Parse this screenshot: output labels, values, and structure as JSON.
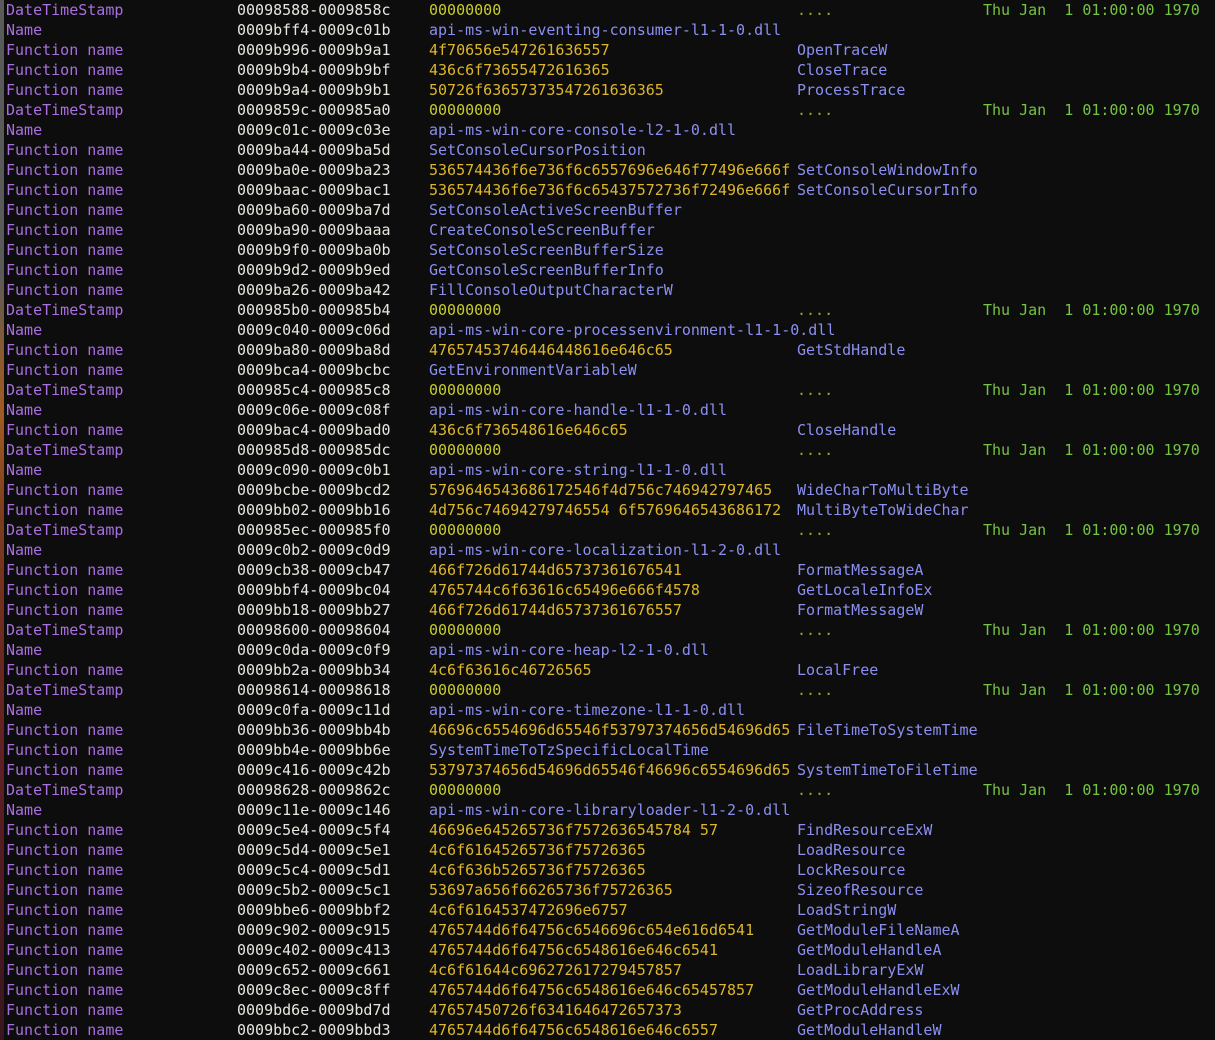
{
  "terminal": {
    "background": "#0d0d0d",
    "colors": {
      "label": "#a96fe0",
      "range": "#e8e6df",
      "hex": "#ddb62c",
      "zero": "#c8cc2e",
      "dots": "#9aa830",
      "name": "#8b8ff0",
      "date": "#74c441"
    },
    "dots_value": "....",
    "edge_strip": "scroll-position-indicator"
  },
  "rows": [
    {
      "label": "DateTimeStamp",
      "range": "00098588-0009858c",
      "value": "00000000",
      "kind": "zero",
      "fn": "....",
      "date": "Thu Jan  1 01:00:00 1970"
    },
    {
      "label": "Name",
      "range": "0009bff4-0009c01b",
      "value": "api-ms-win-eventing-consumer-l1-1-0.dll",
      "kind": "modname",
      "fn": "",
      "date": ""
    },
    {
      "label": "Function name",
      "range": "0009b996-0009b9a1",
      "value": "4f70656e547261636557",
      "kind": "hex",
      "fn": "OpenTraceW",
      "date": ""
    },
    {
      "label": "Function name",
      "range": "0009b9b4-0009b9bf",
      "value": "436c6f73655472616365",
      "kind": "hex",
      "fn": "CloseTrace",
      "date": ""
    },
    {
      "label": "Function name",
      "range": "0009b9a4-0009b9b1",
      "value": "50726f63657373547261636365",
      "kind": "hex",
      "fn": "ProcessTrace",
      "date": ""
    },
    {
      "label": "DateTimeStamp",
      "range": "0009859c-000985a0",
      "value": "00000000",
      "kind": "zero",
      "fn": "....",
      "date": "Thu Jan  1 01:00:00 1970"
    },
    {
      "label": "Name",
      "range": "0009c01c-0009c03e",
      "value": "api-ms-win-core-console-l2-1-0.dll",
      "kind": "modname",
      "fn": "",
      "date": ""
    },
    {
      "label": "Function name",
      "range": "0009ba44-0009ba5d",
      "value": "SetConsoleCursorPosition",
      "kind": "modname",
      "fn": "",
      "date": ""
    },
    {
      "label": "Function name",
      "range": "0009ba0e-0009ba23",
      "value": "536574436f6e736f6c6557696e646f77496e666f",
      "kind": "hex",
      "fn": "SetConsoleWindowInfo",
      "date": ""
    },
    {
      "label": "Function name",
      "range": "0009baac-0009bac1",
      "value": "536574436f6e736f6c65437572736f72496e666f",
      "kind": "hex",
      "fn": "SetConsoleCursorInfo",
      "date": ""
    },
    {
      "label": "Function name",
      "range": "0009ba60-0009ba7d",
      "value": "SetConsoleActiveScreenBuffer",
      "kind": "modname",
      "fn": "",
      "date": ""
    },
    {
      "label": "Function name",
      "range": "0009ba90-0009baaa",
      "value": "CreateConsoleScreenBuffer",
      "kind": "modname",
      "fn": "",
      "date": ""
    },
    {
      "label": "Function name",
      "range": "0009b9f0-0009ba0b",
      "value": "SetConsoleScreenBufferSize",
      "kind": "modname",
      "fn": "",
      "date": ""
    },
    {
      "label": "Function name",
      "range": "0009b9d2-0009b9ed",
      "value": "GetConsoleScreenBufferInfo",
      "kind": "modname",
      "fn": "",
      "date": ""
    },
    {
      "label": "Function name",
      "range": "0009ba26-0009ba42",
      "value": "FillConsoleOutputCharacterW",
      "kind": "modname",
      "fn": "",
      "date": ""
    },
    {
      "label": "DateTimeStamp",
      "range": "000985b0-000985b4",
      "value": "00000000",
      "kind": "zero",
      "fn": "....",
      "date": "Thu Jan  1 01:00:00 1970"
    },
    {
      "label": "Name",
      "range": "0009c040-0009c06d",
      "value": "api-ms-win-core-processenvironment-l1-1-0.dll",
      "kind": "modname",
      "fn": "",
      "date": ""
    },
    {
      "label": "Function name",
      "range": "0009ba80-0009ba8d",
      "value": "47657453746446448616e646c65",
      "kind": "hex",
      "fn": "GetStdHandle",
      "date": ""
    },
    {
      "label": "Function name",
      "range": "0009bca4-0009bcbc",
      "value": "GetEnvironmentVariableW",
      "kind": "modname",
      "fn": "",
      "date": ""
    },
    {
      "label": "DateTimeStamp",
      "range": "000985c4-000985c8",
      "value": "00000000",
      "kind": "zero",
      "fn": "....",
      "date": "Thu Jan  1 01:00:00 1970"
    },
    {
      "label": "Name",
      "range": "0009c06e-0009c08f",
      "value": "api-ms-win-core-handle-l1-1-0.dll",
      "kind": "modname",
      "fn": "",
      "date": ""
    },
    {
      "label": "Function name",
      "range": "0009bac4-0009bad0",
      "value": "436c6f736548616e646c65",
      "kind": "hex",
      "fn": "CloseHandle",
      "date": ""
    },
    {
      "label": "DateTimeStamp",
      "range": "000985d8-000985dc",
      "value": "00000000",
      "kind": "zero",
      "fn": "....",
      "date": "Thu Jan  1 01:00:00 1970"
    },
    {
      "label": "Name",
      "range": "0009c090-0009c0b1",
      "value": "api-ms-win-core-string-l1-1-0.dll",
      "kind": "modname",
      "fn": "",
      "date": ""
    },
    {
      "label": "Function name",
      "range": "0009bcbe-0009bcd2",
      "value": "5769646543686172546f4d756c746942797465",
      "kind": "hex",
      "fn": "WideCharToMultiByte",
      "date": ""
    },
    {
      "label": "Function name",
      "range": "0009bb02-0009bb16",
      "value": "4d756c74694279746554 6f5769646543686172",
      "kind": "hex",
      "fn": "MultiByteToWideChar",
      "date": ""
    },
    {
      "label": "DateTimeStamp",
      "range": "000985ec-000985f0",
      "value": "00000000",
      "kind": "zero",
      "fn": "....",
      "date": "Thu Jan  1 01:00:00 1970"
    },
    {
      "label": "Name",
      "range": "0009c0b2-0009c0d9",
      "value": "api-ms-win-core-localization-l1-2-0.dll",
      "kind": "modname",
      "fn": "",
      "date": ""
    },
    {
      "label": "Function name",
      "range": "0009cb38-0009cb47",
      "value": "466f726d61744d65737361676541",
      "kind": "hex",
      "fn": "FormatMessageA",
      "date": ""
    },
    {
      "label": "Function name",
      "range": "0009bbf4-0009bc04",
      "value": "4765744c6f63616c65496e666f4578",
      "kind": "hex",
      "fn": "GetLocaleInfoEx",
      "date": ""
    },
    {
      "label": "Function name",
      "range": "0009bb18-0009bb27",
      "value": "466f726d61744d65737361676557",
      "kind": "hex",
      "fn": "FormatMessageW",
      "date": ""
    },
    {
      "label": "DateTimeStamp",
      "range": "00098600-00098604",
      "value": "00000000",
      "kind": "zero",
      "fn": "....",
      "date": "Thu Jan  1 01:00:00 1970"
    },
    {
      "label": "Name",
      "range": "0009c0da-0009c0f9",
      "value": "api-ms-win-core-heap-l2-1-0.dll",
      "kind": "modname",
      "fn": "",
      "date": ""
    },
    {
      "label": "Function name",
      "range": "0009bb2a-0009bb34",
      "value": "4c6f63616c46726565",
      "kind": "hex",
      "fn": "LocalFree",
      "date": ""
    },
    {
      "label": "DateTimeStamp",
      "range": "00098614-00098618",
      "value": "00000000",
      "kind": "zero",
      "fn": "....",
      "date": "Thu Jan  1 01:00:00 1970"
    },
    {
      "label": "Name",
      "range": "0009c0fa-0009c11d",
      "value": "api-ms-win-core-timezone-l1-1-0.dll",
      "kind": "modname",
      "fn": "",
      "date": ""
    },
    {
      "label": "Function name",
      "range": "0009bb36-0009bb4b",
      "value": "46696c6554696d65546f53797374656d54696d65",
      "kind": "hex",
      "fn": "FileTimeToSystemTime",
      "date": ""
    },
    {
      "label": "Function name",
      "range": "0009bb4e-0009bb6e",
      "value": "SystemTimeToTzSpecificLocalTime",
      "kind": "modname",
      "fn": "",
      "date": ""
    },
    {
      "label": "Function name",
      "range": "0009c416-0009c42b",
      "value": "53797374656d54696d65546f46696c6554696d65",
      "kind": "hex",
      "fn": "SystemTimeToFileTime",
      "date": ""
    },
    {
      "label": "DateTimeStamp",
      "range": "00098628-0009862c",
      "value": "00000000",
      "kind": "zero",
      "fn": "....",
      "date": "Thu Jan  1 01:00:00 1970"
    },
    {
      "label": "Name",
      "range": "0009c11e-0009c146",
      "value": "api-ms-win-core-libraryloader-l1-2-0.dll",
      "kind": "modname",
      "fn": "",
      "date": ""
    },
    {
      "label": "Function name",
      "range": "0009c5e4-0009c5f4",
      "value": "46696e645265736f7572636545784 57",
      "kind": "hex",
      "fn": "FindResourceExW",
      "date": ""
    },
    {
      "label": "Function name",
      "range": "0009c5d4-0009c5e1",
      "value": "4c6f61645265736f75726365",
      "kind": "hex",
      "fn": "LoadResource",
      "date": ""
    },
    {
      "label": "Function name",
      "range": "0009c5c4-0009c5d1",
      "value": "4c6f636b5265736f75726365",
      "kind": "hex",
      "fn": "LockResource",
      "date": ""
    },
    {
      "label": "Function name",
      "range": "0009c5b2-0009c5c1",
      "value": "53697a656f66265736f75726365",
      "kind": "hex",
      "fn": "SizeofResource",
      "date": ""
    },
    {
      "label": "Function name",
      "range": "0009bbe6-0009bbf2",
      "value": "4c6f6164537472696e6757",
      "kind": "hex",
      "fn": "LoadStringW",
      "date": ""
    },
    {
      "label": "Function name",
      "range": "0009c902-0009c915",
      "value": "4765744d6f64756c6546696c654e616d6541",
      "kind": "hex",
      "fn": "GetModuleFileNameA",
      "date": ""
    },
    {
      "label": "Function name",
      "range": "0009c402-0009c413",
      "value": "4765744d6f64756c6548616e646c6541",
      "kind": "hex",
      "fn": "GetModuleHandleA",
      "date": ""
    },
    {
      "label": "Function name",
      "range": "0009c652-0009c661",
      "value": "4c6f61644c696272617279457857",
      "kind": "hex",
      "fn": "LoadLibraryExW",
      "date": ""
    },
    {
      "label": "Function name",
      "range": "0009c8ec-0009c8ff",
      "value": "4765744d6f64756c6548616e646c65457857",
      "kind": "hex",
      "fn": "GetModuleHandleExW",
      "date": ""
    },
    {
      "label": "Function name",
      "range": "0009bd6e-0009bd7d",
      "value": "47657450726f6341646472657373",
      "kind": "hex",
      "fn": "GetProcAddress",
      "date": ""
    },
    {
      "label": "Function name",
      "range": "0009bbc2-0009bbd3",
      "value": "4765744d6f64756c6548616e646c6557",
      "kind": "hex",
      "fn": "GetModuleHandleW",
      "date": ""
    }
  ]
}
